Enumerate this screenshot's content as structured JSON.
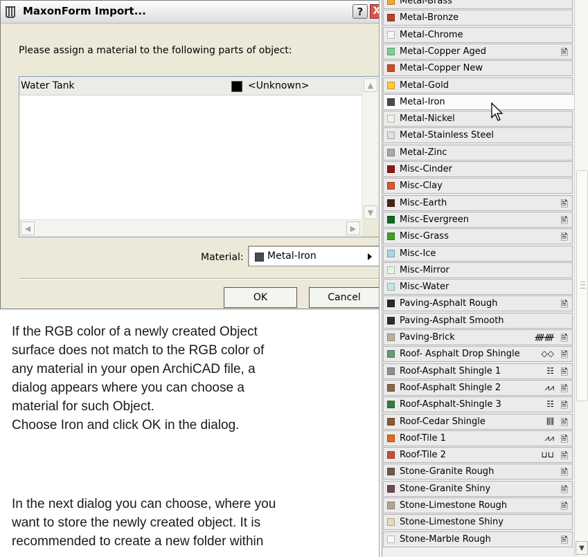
{
  "dialog": {
    "title": "MaxonForm Import...",
    "help_label": "?",
    "close_label": "X",
    "instruction": "Please assign a material to the following parts of object:",
    "parts": [
      {
        "name": "Water Tank",
        "material": "<Unknown>",
        "swatch_color": "#000000"
      }
    ],
    "material_label": "Material:",
    "material_value": "Metal-Iron",
    "material_color": "#4b4b4f",
    "ok_label": "OK",
    "cancel_label": "Cancel"
  },
  "description": {
    "lines": [
      "If the RGB color of a newly created Object",
      "surface does not match to the RGB color of",
      "any material in your open ArchiCAD file, a",
      "dialog appears where you can choose a",
      "material for such Object.",
      "Choose Iron and click OK in the dialog."
    ],
    "lines2": [
      "In the next dialog you can choose, where you",
      "want to store the newly created object. It is",
      "recommended to create a new folder within"
    ]
  },
  "materials": [
    {
      "name": "Metal-Brass",
      "color": "#f5a623",
      "tex": "",
      "doc": false
    },
    {
      "name": "Metal-Bronze",
      "color": "#b5432a",
      "tex": "",
      "doc": false
    },
    {
      "name": "Metal-Chrome",
      "color": "#f6f6f6",
      "tex": "",
      "doc": false
    },
    {
      "name": "Metal-Copper Aged",
      "color": "#7ccf93",
      "tex": "",
      "doc": true
    },
    {
      "name": "Metal-Copper New",
      "color": "#d14b2a",
      "tex": "",
      "doc": false
    },
    {
      "name": "Metal-Gold",
      "color": "#ffc83d",
      "tex": "",
      "doc": false
    },
    {
      "name": "Metal-Iron",
      "color": "#4b4b4f",
      "tex": "",
      "doc": false,
      "hover": true
    },
    {
      "name": "Metal-Nickel",
      "color": "#f7efe6",
      "tex": "",
      "doc": false
    },
    {
      "name": "Metal-Stainless Steel",
      "color": "#e1e1e1",
      "tex": "",
      "doc": false
    },
    {
      "name": "Metal-Zinc",
      "color": "#a9a9a9",
      "tex": "",
      "doc": false
    },
    {
      "name": "Misc-Cinder",
      "color": "#8b1a12",
      "tex": "",
      "doc": false
    },
    {
      "name": "Misc-Clay",
      "color": "#d9562e",
      "tex": "",
      "doc": false
    },
    {
      "name": "Misc-Earth",
      "color": "#4d2414",
      "tex": "",
      "doc": true
    },
    {
      "name": "Misc-Evergreen",
      "color": "#0c6b1e",
      "tex": "",
      "doc": true
    },
    {
      "name": "Misc-Grass",
      "color": "#3fa12a",
      "tex": "",
      "doc": true
    },
    {
      "name": "Misc-Ice",
      "color": "#a9d6e2",
      "tex": "",
      "doc": false
    },
    {
      "name": "Misc-Mirror",
      "color": "#e9f3e2",
      "tex": "",
      "doc": false
    },
    {
      "name": "Misc-Water",
      "color": "#c9e6e6",
      "tex": "",
      "doc": false
    },
    {
      "name": "Paving-Asphalt Rough",
      "color": "#2a2a2a",
      "tex": "",
      "doc": true
    },
    {
      "name": "Paving-Asphalt Smooth",
      "color": "#2e2e2e",
      "tex": "",
      "doc": false
    },
    {
      "name": "Paving-Brick",
      "color": "#b7b39c",
      "tex": "ᚎᚎ",
      "doc": true
    },
    {
      "name": "Roof- Asphalt Drop Shingle",
      "color": "#6a9a78",
      "tex": "◇◇",
      "doc": true
    },
    {
      "name": "Roof-Asphalt Shingle 1",
      "color": "#8f8f8f",
      "tex": "☷",
      "doc": true
    },
    {
      "name": "Roof-Asphalt Shingle 2",
      "color": "#8a6a45",
      "tex": "⩘⩘",
      "doc": true
    },
    {
      "name": "Roof-Asphalt-Shingle 3",
      "color": "#3a7a3f",
      "tex": "☷",
      "doc": true
    },
    {
      "name": "Roof-Cedar Shingle",
      "color": "#8a5a35",
      "tex": "⫼⫼",
      "doc": true
    },
    {
      "name": "Roof-Tile 1",
      "color": "#e36a1b",
      "tex": "⩘⩘",
      "doc": true
    },
    {
      "name": "Roof-Tile 2",
      "color": "#cf4b3f",
      "tex": "⊔⊔",
      "doc": true
    },
    {
      "name": "Stone-Granite Rough",
      "color": "#6e5a49",
      "tex": "",
      "doc": true
    },
    {
      "name": "Stone-Granite Shiny",
      "color": "#6e4a50",
      "tex": "",
      "doc": true
    },
    {
      "name": "Stone-Limestone Rough",
      "color": "#b3a68f",
      "tex": "",
      "doc": true
    },
    {
      "name": "Stone-Limestone Shiny",
      "color": "#e7dcb8",
      "tex": "",
      "doc": false
    },
    {
      "name": "Stone-Marble Rough",
      "color": "#f8f8f8",
      "tex": "",
      "doc": true
    }
  ]
}
